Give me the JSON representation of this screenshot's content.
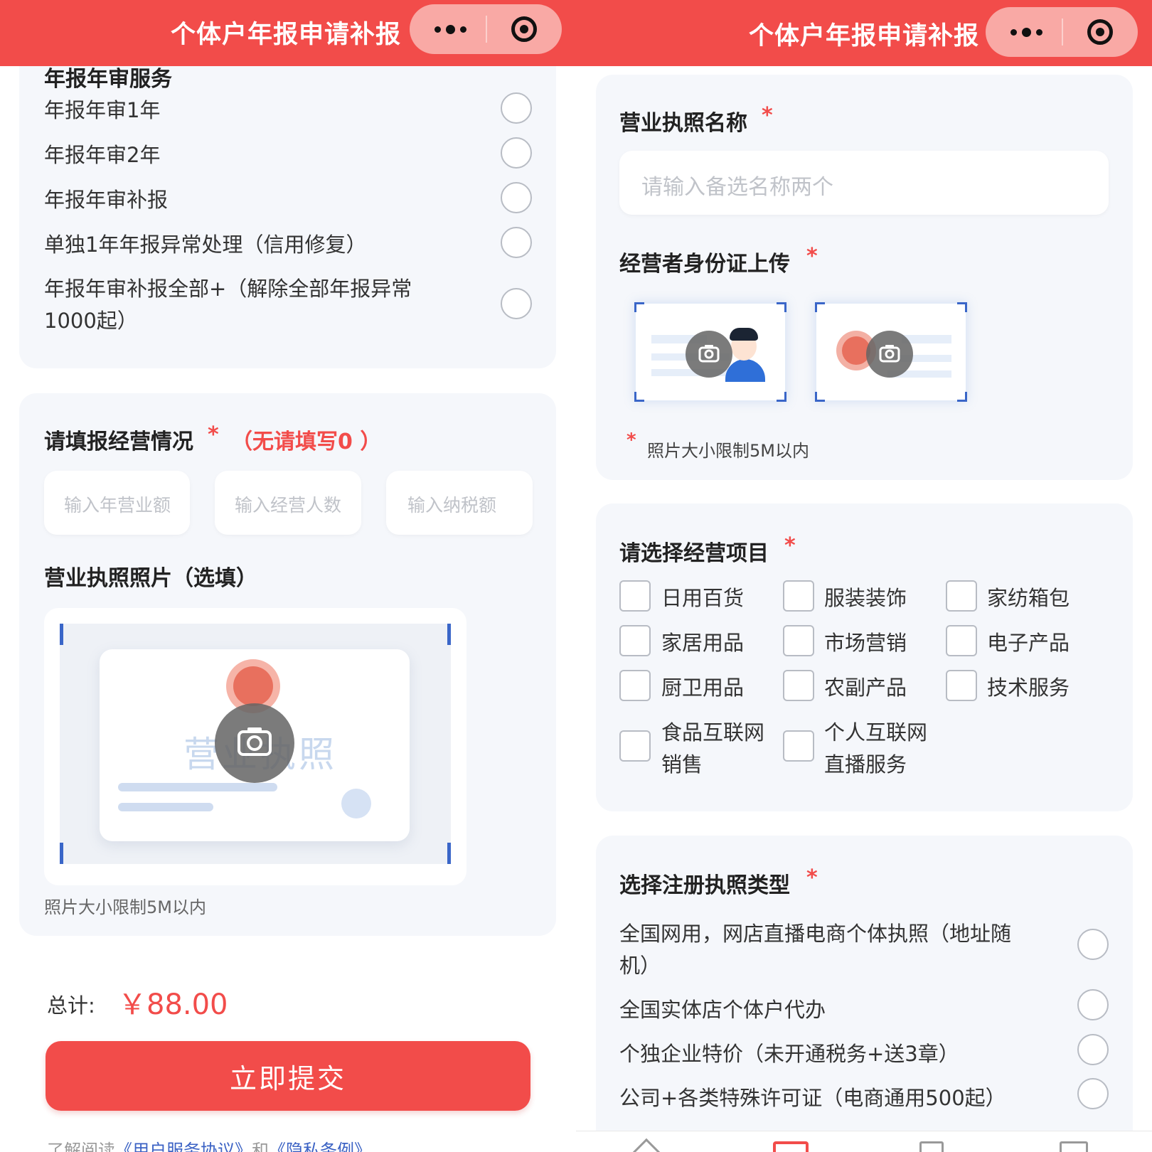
{
  "app": {
    "title": "个体户年报申请补报",
    "capsule": {
      "more_icon": "more-dots-icon",
      "close_icon": "target-circle-icon"
    }
  },
  "left": {
    "partial_heading": "年报年审服务",
    "services": [
      {
        "label": "年报年审1年"
      },
      {
        "label": "年报年审2年"
      },
      {
        "label": "年报年审补报"
      },
      {
        "label": "单独1年年报异常处理（信用修复）"
      },
      {
        "label_line1": "年报年审补报全部+（解除全部年报异常",
        "label_line2": "1000起）"
      }
    ],
    "business": {
      "title": "请填报经营情况",
      "required_mark": "*",
      "note": "（无请填写0 ）",
      "inputs": [
        {
          "placeholder": "输入年营业额"
        },
        {
          "placeholder": "输入经营人数"
        },
        {
          "placeholder": "输入纳税额"
        }
      ]
    },
    "license_photo": {
      "title": "营业执照照片（选填）",
      "preview_text": "营业执照",
      "size_hint": "照片大小限制5M以内"
    },
    "total": {
      "label": "总计:",
      "amount": "￥88.00"
    },
    "submit_label": "立即提交",
    "agreement": {
      "prefix": "了解阅读",
      "link1": "《用户服务协议》",
      "and": "和",
      "link2": "《隐私条例》"
    }
  },
  "right": {
    "license_name": {
      "title": "营业执照名称",
      "required_mark": "*",
      "placeholder": "请输入备选名称两个"
    },
    "id_upload": {
      "title": "经营者身份证上传",
      "required_mark": "*",
      "hint_mark": "*",
      "size_hint": "照片大小限制5M以内"
    },
    "business_items": {
      "title": "请选择经营项目",
      "required_mark": "*",
      "options": [
        {
          "label": "日用百货"
        },
        {
          "label": "服装装饰"
        },
        {
          "label": "家纺箱包"
        },
        {
          "label": "家居用品"
        },
        {
          "label": "市场营销"
        },
        {
          "label": "电子产品"
        },
        {
          "label": "厨卫用品"
        },
        {
          "label": "农副产品"
        },
        {
          "label": "技术服务"
        },
        {
          "line1": "食品互联网",
          "line2": "销售"
        },
        {
          "line1": "个人互联网",
          "line2": "直播服务"
        }
      ]
    },
    "license_type": {
      "title": "选择注册执照类型",
      "required_mark": "*",
      "options": [
        {
          "line1": "全国网用，网店直播电商个体执照（地址随",
          "line2": "机）"
        },
        {
          "label": "全国实体店个体户代办"
        },
        {
          "label": "个独企业特价（未开通税务+送3章）"
        },
        {
          "label": "公司+各类特殊许可证（电商通用500起）"
        }
      ]
    }
  },
  "colors": {
    "brand_red": "#f24c4a",
    "card_bg": "#f5f7fb",
    "placeholder": "#c0c3c9",
    "link_blue": "#3b62c4"
  }
}
